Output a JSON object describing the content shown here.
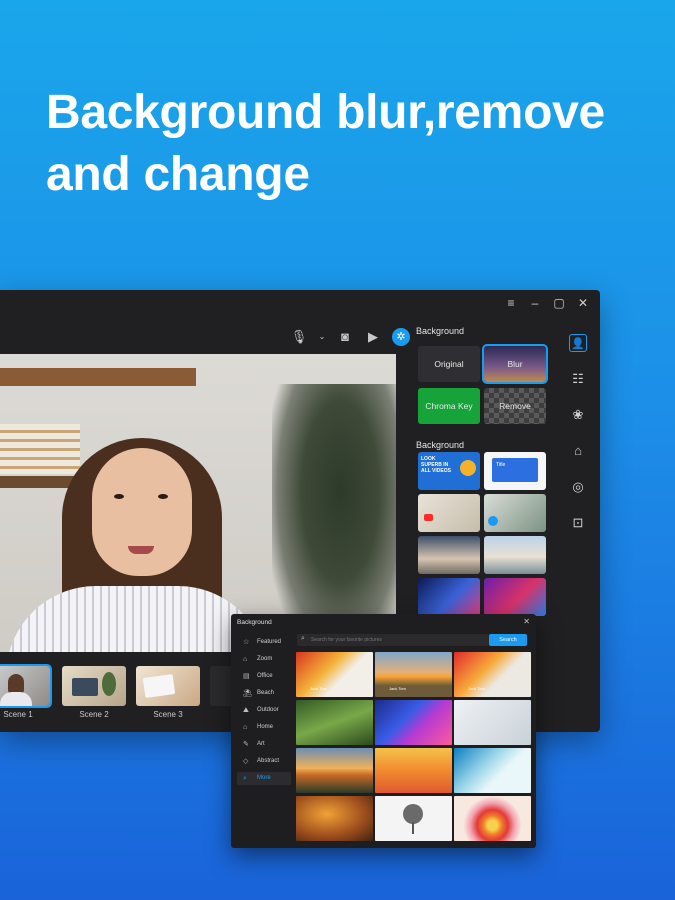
{
  "headline": "Background blur,remove and change",
  "window": {
    "controls": [
      "menu-icon",
      "minimize-icon",
      "maximize-icon",
      "close-icon"
    ]
  },
  "toolbar": {
    "icons": [
      "microphone-icon",
      "chevron-down-icon",
      "camera-icon",
      "video-icon",
      "background-icon"
    ]
  },
  "scenes": [
    {
      "label": "Scene 1",
      "active": true
    },
    {
      "label": "Scene 2",
      "active": false
    },
    {
      "label": "Scene 3",
      "active": false
    }
  ],
  "panel": {
    "title": "Background",
    "options": [
      {
        "label": "Original",
        "color": "#2f2f33"
      },
      {
        "label": "Blur",
        "color": "#3a3360"
      },
      {
        "label": "Chroma Key",
        "color": "#16a33a"
      },
      {
        "label": "Remove",
        "color": "#4a4a4a"
      }
    ],
    "section_title": "Background",
    "thumb_text": {
      "t1": "LOOK SUPERB IN ALL VIDEOS",
      "t2": "Title"
    }
  },
  "side_icons": [
    "person-icon",
    "adjust-icon",
    "filter-icon",
    "sticker-icon",
    "mask-icon",
    "ar-icon"
  ],
  "dialog": {
    "title": "Background",
    "search_placeholder": "Search for your favorite pictures",
    "search_button": "Search",
    "categories": [
      {
        "label": "Featured",
        "icon": "star-icon"
      },
      {
        "label": "Zoom",
        "icon": "home-icon"
      },
      {
        "label": "Office",
        "icon": "office-icon"
      },
      {
        "label": "Beach",
        "icon": "beach-icon"
      },
      {
        "label": "Outdoor",
        "icon": "outdoor-icon"
      },
      {
        "label": "Home",
        "icon": "house-icon"
      },
      {
        "label": "Art",
        "icon": "art-icon"
      },
      {
        "label": "Abstract",
        "icon": "abstract-icon"
      },
      {
        "label": "More",
        "icon": "search-icon",
        "active": true
      }
    ],
    "thumb_caption": "Jack Tom"
  },
  "accent": "#1a9bf0"
}
